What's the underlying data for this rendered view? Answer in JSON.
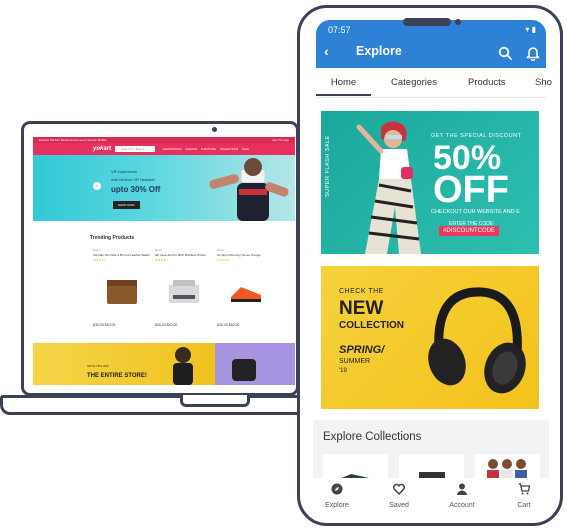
{
  "laptop": {
    "website": {
      "topbar_left": "Explore Kitchen Mobile Ecommerce Source Mobile",
      "topbar_right": "Get The App",
      "logo": "yokart",
      "search_placeholder": "Search for Brand",
      "menu": [
        "ELECTRONICS",
        "FASHION",
        "FURNITURE",
        "COLLECTIONS",
        "SALE"
      ],
      "hero": {
        "line1": "VR experience",
        "line2": "with Nexbro VR Headset",
        "line3": "upto 30% Off",
        "button": "SHOP NOW"
      },
      "section_title": "Trending Products",
      "products": [
        {
          "sub": "Brand",
          "name": "Via Mac Slim Men's Bi Fold Leather Wallet",
          "stars": "★★★★☆",
          "price": "$30.00  $40.00"
        },
        {
          "sub": "Brand",
          "name": "HP LaserJet Pro MFP M126nw Printer",
          "stars": "★★★★☆",
          "price": "$30.00  $40.00"
        },
        {
          "sub": "Brand",
          "name": "Air Sport Running Shoes Orange",
          "stars": "★★★★☆",
          "price": "$30.00  $40.00"
        }
      ],
      "banner": {
        "line1": "UPTO 75% OFF",
        "line2": "THE ENTIRE STORE!"
      }
    }
  },
  "phone": {
    "status_time": "07:57",
    "status_icons": "▾ ▮",
    "app_title": "Explore",
    "tabs": [
      "Home",
      "Categories",
      "Products",
      "Sho"
    ],
    "active_tab": "Home",
    "banner1": {
      "side": "SUPER FLASH SALE",
      "get": "GET THE SPECIAL DISCOUNT",
      "big1": "50%",
      "big2": "OFF",
      "check": "CHECKOUT OUR WEBSITE AND E",
      "enter": "ENTER THE CODE:",
      "code": "#DISCOUNTCODE"
    },
    "banner2": {
      "check": "CHECK THE",
      "new": "NEW",
      "collection": "COLLECTION",
      "spring": "SPRING/",
      "summer": "SUMMER",
      "year": "'19"
    },
    "collections_title": "Explore Collections",
    "bottom_nav": [
      {
        "label": "Explore",
        "icon": "compass-icon"
      },
      {
        "label": "Saved",
        "icon": "heart-icon"
      },
      {
        "label": "Account",
        "icon": "user-icon"
      },
      {
        "label": "Cart",
        "icon": "cart-icon"
      }
    ],
    "colors": {
      "primary": "#2d82d6",
      "accent": "#e83a5a"
    }
  }
}
